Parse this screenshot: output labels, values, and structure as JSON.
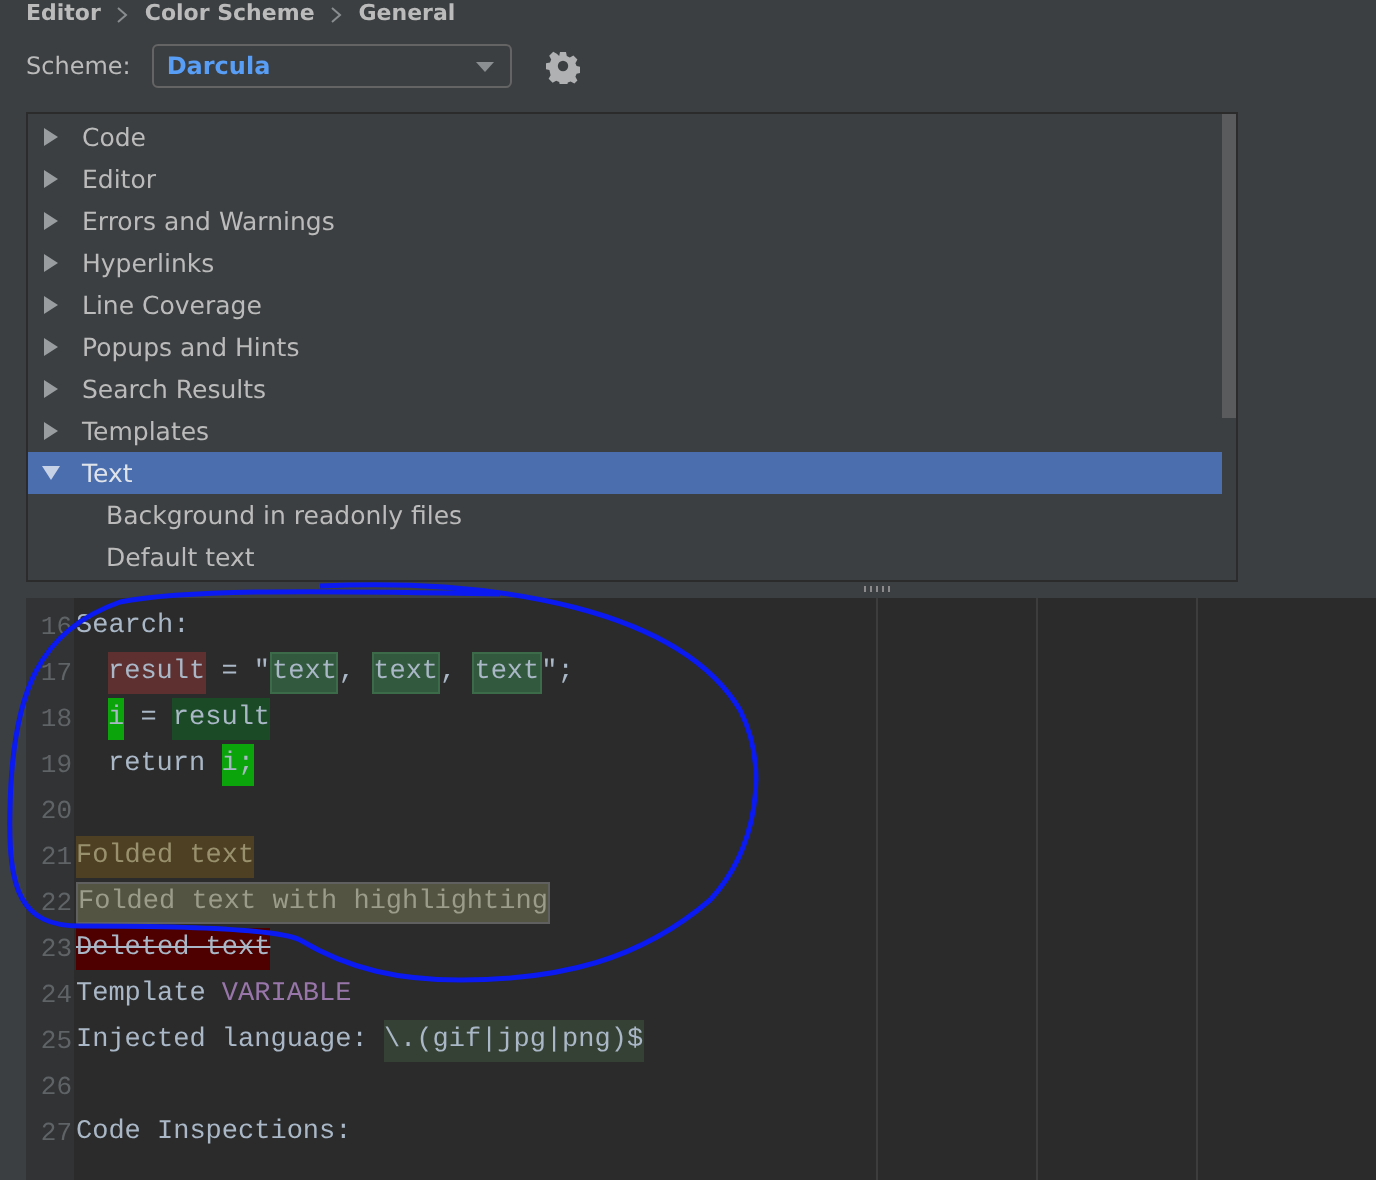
{
  "breadcrumb": [
    "Editor",
    "Color Scheme",
    "General"
  ],
  "scheme": {
    "label": "Scheme:",
    "value": "Darcula"
  },
  "tree": {
    "items": [
      {
        "label": "Code",
        "expanded": false,
        "selected": false
      },
      {
        "label": "Editor",
        "expanded": false,
        "selected": false
      },
      {
        "label": "Errors and Warnings",
        "expanded": false,
        "selected": false
      },
      {
        "label": "Hyperlinks",
        "expanded": false,
        "selected": false
      },
      {
        "label": "Line Coverage",
        "expanded": false,
        "selected": false
      },
      {
        "label": "Popups and Hints",
        "expanded": false,
        "selected": false
      },
      {
        "label": "Search Results",
        "expanded": false,
        "selected": false
      },
      {
        "label": "Templates",
        "expanded": false,
        "selected": false
      },
      {
        "label": "Text",
        "expanded": true,
        "selected": true,
        "children": [
          {
            "label": "Background in readonly files",
            "selected": false
          },
          {
            "label": "Default text",
            "selected": false
          }
        ]
      }
    ]
  },
  "preview": {
    "lines": [
      {
        "number": "16",
        "indented": false,
        "segments": [
          {
            "text": "Search:",
            "kind": "plain"
          }
        ]
      },
      {
        "number": "17",
        "indented": true,
        "segments": [
          {
            "text": "result",
            "kind": "search-result"
          },
          {
            "text": " = \"",
            "kind": "plain"
          },
          {
            "text": "text",
            "kind": "search-text"
          },
          {
            "text": ", ",
            "kind": "plain"
          },
          {
            "text": "text",
            "kind": "search-text"
          },
          {
            "text": ", ",
            "kind": "plain"
          },
          {
            "text": "text",
            "kind": "search-text"
          },
          {
            "text": "\";",
            "kind": "plain"
          }
        ]
      },
      {
        "number": "18",
        "indented": true,
        "segments": [
          {
            "text": "i",
            "kind": "write-usage"
          },
          {
            "text": " = ",
            "kind": "plain"
          },
          {
            "text": "result",
            "kind": "read-usage"
          }
        ]
      },
      {
        "number": "19",
        "indented": true,
        "segments": [
          {
            "text": "return ",
            "kind": "plain"
          },
          {
            "text": "i;",
            "kind": "write-usage"
          }
        ]
      },
      {
        "number": "20",
        "indented": false
      },
      {
        "number": "21",
        "indented": false,
        "segments": [
          {
            "text": "Folded text",
            "kind": "folded"
          }
        ]
      },
      {
        "number": "22",
        "indented": false,
        "segments": [
          {
            "text": "Folded text with highlighting",
            "kind": "folded-highlighted"
          }
        ]
      },
      {
        "number": "23",
        "indented": false,
        "segments": [
          {
            "text": "Deleted text",
            "kind": "deleted"
          }
        ]
      },
      {
        "number": "24",
        "indented": false,
        "segments": [
          {
            "text": "Template ",
            "kind": "plain"
          },
          {
            "text": "VARIABLE",
            "kind": "template-variable"
          }
        ]
      },
      {
        "number": "25",
        "indented": false,
        "segments": [
          {
            "text": "Injected language: ",
            "kind": "plain"
          },
          {
            "text": "\\.(gif|jpg|png)$",
            "kind": "injected"
          }
        ]
      },
      {
        "number": "26",
        "indented": false
      },
      {
        "number": "27",
        "indented": false,
        "segments": [
          {
            "text": "Code Inspections:",
            "kind": "plain"
          }
        ]
      }
    ]
  }
}
